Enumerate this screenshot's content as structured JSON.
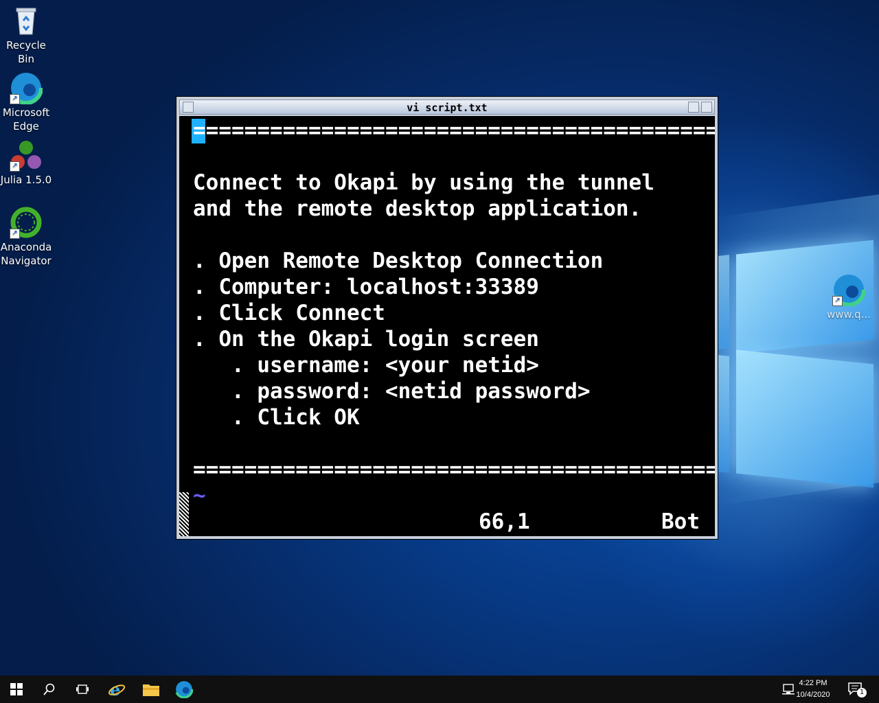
{
  "desktop": {
    "icons": [
      {
        "label": "Recycle Bin",
        "icon": "recycle-bin-icon"
      },
      {
        "label": "Microsoft Edge",
        "icon": "edge-icon"
      },
      {
        "label": "Julia 1.5.0",
        "icon": "julia-icon"
      },
      {
        "label": "Anaconda Navigator",
        "icon": "anaconda-icon"
      },
      {
        "label": "www.q...",
        "icon": "edge-icon"
      }
    ]
  },
  "vi_window": {
    "title": "vi script.txt",
    "lines": [
      "=========================================",
      "",
      "Connect to Okapi by using the tunnel",
      "and the remote desktop application.",
      "",
      ". Open Remote Desktop Connection",
      ". Computer: localhost:33389",
      ". Click Connect",
      ". On the Okapi login screen",
      "   . username: <your netid>",
      "   . password: <netid password>",
      "   . Click OK",
      "",
      "=========================================",
      "~"
    ],
    "status_position": "66,1",
    "status_scroll": "Bot",
    "cursor_color": "#1fb0ff",
    "tilde_color": "#6a5cff"
  },
  "taskbar": {
    "items": [
      "start-icon",
      "search-icon",
      "task-view-icon",
      "internet-explorer-icon",
      "file-explorer-icon",
      "edge-icon"
    ],
    "time": "4:22 PM",
    "date": "10/4/2020",
    "notification_count": "1"
  }
}
